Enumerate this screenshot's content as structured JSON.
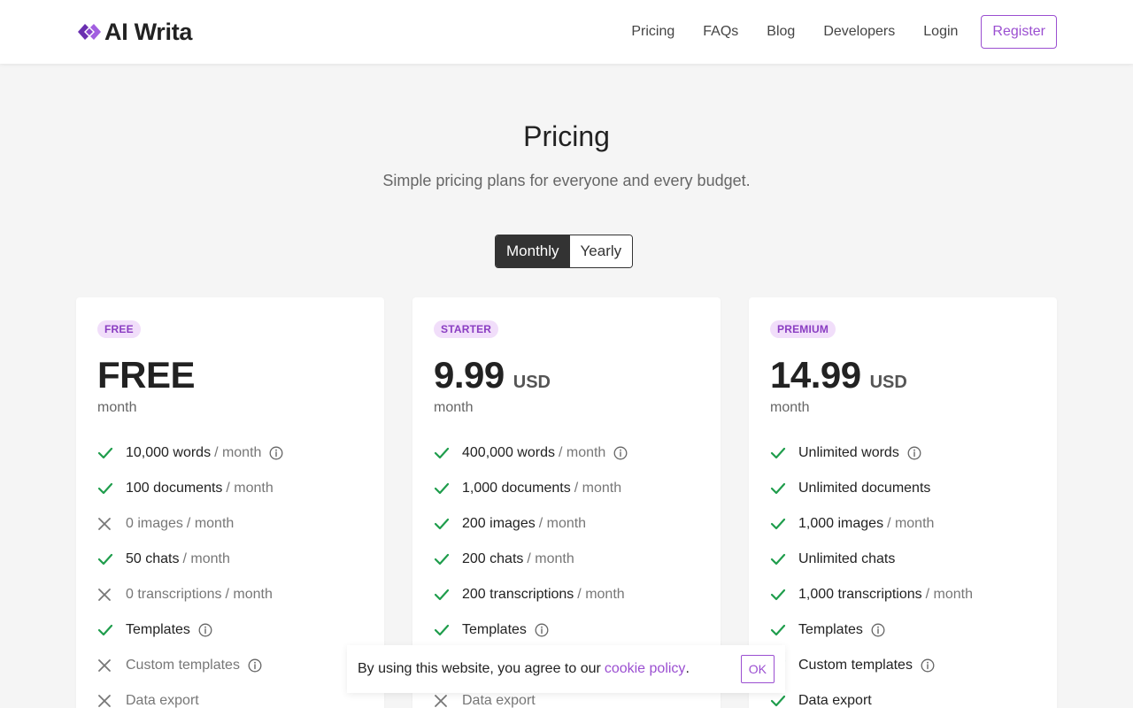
{
  "brand": {
    "name": "AI Writa",
    "accent": "#9b4fd1",
    "logo_icon": "diamond-logo-icon"
  },
  "nav": {
    "links": [
      "Pricing",
      "FAQs",
      "Blog",
      "Developers",
      "Login"
    ],
    "register_label": "Register"
  },
  "hero": {
    "title": "Pricing",
    "subtitle": "Simple pricing plans for everyone and every budget."
  },
  "billing_toggle": {
    "monthly": "Monthly",
    "yearly": "Yearly",
    "selected": "Monthly"
  },
  "plans": [
    {
      "badge": "FREE",
      "price": "FREE",
      "currency": "",
      "period": "month",
      "features": [
        {
          "label": "10,000 words",
          "per": "/ month",
          "included": true,
          "info": true
        },
        {
          "label": "100 documents",
          "per": "/ month",
          "included": true,
          "info": false
        },
        {
          "label": "0 images",
          "per": "/ month",
          "included": false,
          "info": false
        },
        {
          "label": "50 chats",
          "per": "/ month",
          "included": true,
          "info": false
        },
        {
          "label": "0 transcriptions",
          "per": "/ month",
          "included": false,
          "info": false
        },
        {
          "label": "Templates",
          "per": "",
          "included": true,
          "info": true
        },
        {
          "label": "Custom templates",
          "per": "",
          "included": false,
          "info": true
        },
        {
          "label": "Data export",
          "per": "",
          "included": false,
          "info": false
        }
      ]
    },
    {
      "badge": "STARTER",
      "price": "9.99",
      "currency": "USD",
      "period": "month",
      "features": [
        {
          "label": "400,000 words",
          "per": "/ month",
          "included": true,
          "info": true
        },
        {
          "label": "1,000 documents",
          "per": "/ month",
          "included": true,
          "info": false
        },
        {
          "label": "200 images",
          "per": "/ month",
          "included": true,
          "info": false
        },
        {
          "label": "200 chats",
          "per": "/ month",
          "included": true,
          "info": false
        },
        {
          "label": "200 transcriptions",
          "per": "/ month",
          "included": true,
          "info": false
        },
        {
          "label": "Templates",
          "per": "",
          "included": true,
          "info": true
        },
        {
          "label": "",
          "per": "",
          "included": true,
          "info": false
        },
        {
          "label": "Data export",
          "per": "",
          "included": false,
          "info": false
        }
      ]
    },
    {
      "badge": "PREMIUM",
      "price": "14.99",
      "currency": "USD",
      "period": "month",
      "features": [
        {
          "label": "Unlimited words",
          "per": "",
          "included": true,
          "info": true
        },
        {
          "label": "Unlimited documents",
          "per": "",
          "included": true,
          "info": false
        },
        {
          "label": "1,000 images",
          "per": "/ month",
          "included": true,
          "info": false
        },
        {
          "label": "Unlimited chats",
          "per": "",
          "included": true,
          "info": false
        },
        {
          "label": "1,000 transcriptions",
          "per": "/ month",
          "included": true,
          "info": false
        },
        {
          "label": "Templates",
          "per": "",
          "included": true,
          "info": true
        },
        {
          "label": "Custom templates",
          "per": "",
          "included": true,
          "info": true
        },
        {
          "label": "Data export",
          "per": "",
          "included": true,
          "info": false
        }
      ]
    }
  ],
  "cookie": {
    "text": "By using this website, you agree to our",
    "link": "cookie policy",
    "suffix": ".",
    "ok_label": "OK"
  },
  "colors": {
    "check": "#1f9d4c",
    "cross": "#777777",
    "badge_bg": "#f1defa",
    "badge_text": "#8a3dc2"
  }
}
